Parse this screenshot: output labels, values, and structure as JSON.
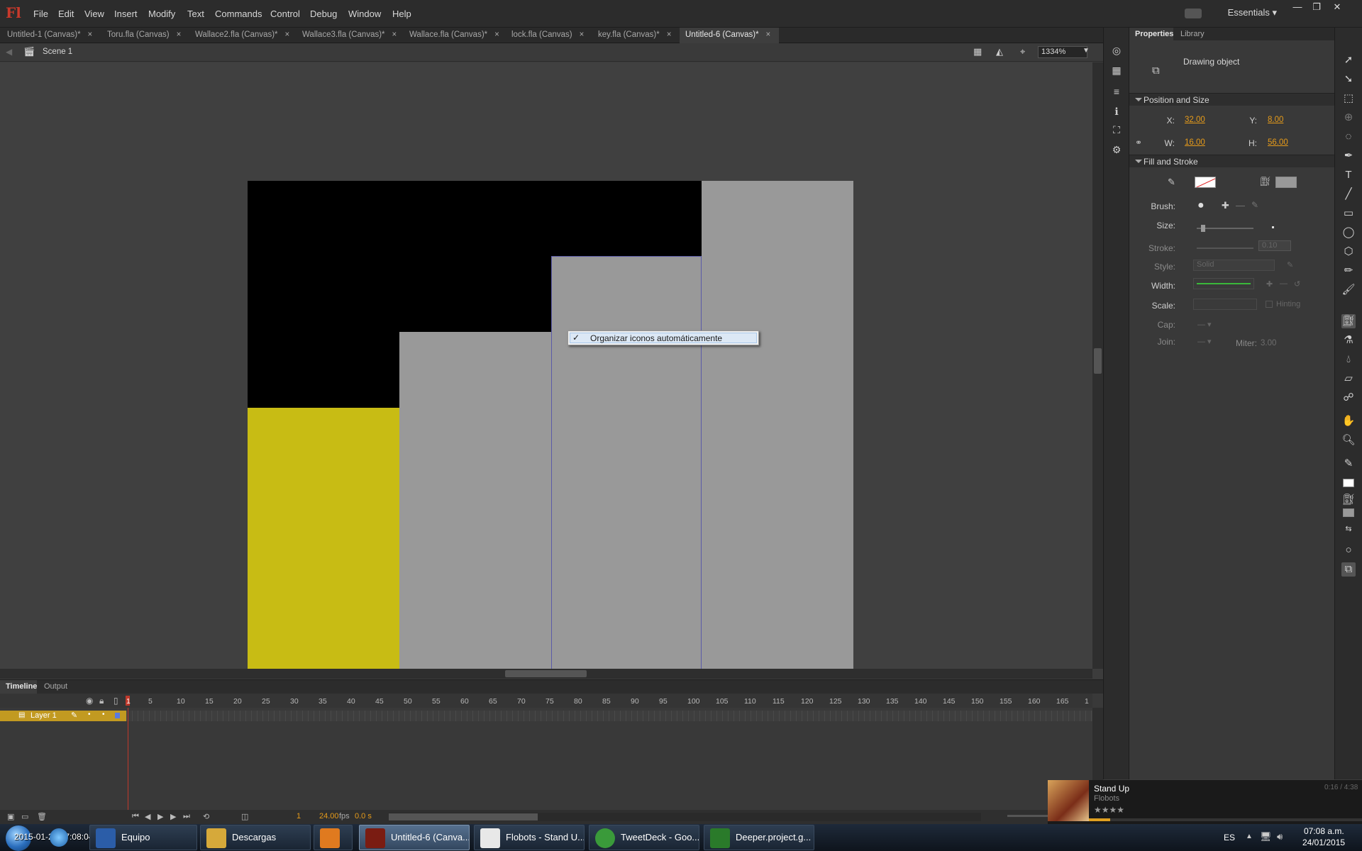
{
  "app": {
    "logo": "Fl"
  },
  "menu": [
    "File",
    "Edit",
    "View",
    "Insert",
    "Modify",
    "Text",
    "Commands",
    "Control",
    "Debug",
    "Window",
    "Help"
  ],
  "workspace": "Essentials",
  "tabs": [
    {
      "label": "Untitled-1 (Canvas)*",
      "active": false
    },
    {
      "label": "Toru.fla (Canvas)",
      "active": false
    },
    {
      "label": "Wallace2.fla (Canvas)*",
      "active": false
    },
    {
      "label": "Wallace3.fla (Canvas)*",
      "active": false
    },
    {
      "label": "Wallace.fla (Canvas)*",
      "active": false
    },
    {
      "label": "lock.fla (Canvas)",
      "active": false
    },
    {
      "label": "key.fla (Canvas)*",
      "active": false
    },
    {
      "label": "Untitled-6 (Canvas)*",
      "active": true
    }
  ],
  "tab_close": "×",
  "editbar": {
    "scene": "Scene 1",
    "zoom": "1334%"
  },
  "stage": {
    "colors": {
      "black": "#000000",
      "gray": "#999999",
      "yellow": "#c8bc14",
      "outline": "#5a5aa8"
    },
    "context_item": {
      "check": "✓",
      "label": "Organizar iconos automáticamente"
    }
  },
  "timeline": {
    "tabs": [
      "Timeline",
      "Output"
    ],
    "layer": "Layer 1",
    "frame_numbers": [
      "1",
      "5",
      "10",
      "15",
      "20",
      "25",
      "30",
      "35",
      "40",
      "45",
      "50",
      "55",
      "60",
      "65",
      "70",
      "75",
      "80",
      "85",
      "90",
      "95",
      "100",
      "105",
      "110",
      "115",
      "120",
      "125",
      "130",
      "135",
      "140",
      "145",
      "150",
      "155",
      "160",
      "165",
      "1"
    ],
    "current_frame": "1",
    "fps": "24.00",
    "fps_unit": "fps",
    "time": "0.0 s"
  },
  "properties": {
    "tabs": [
      "Properties",
      "Library"
    ],
    "object_type": "Drawing object",
    "position_section": "Position and Size",
    "x_label": "X:",
    "x": "32.00",
    "y_label": "Y:",
    "y": "8.00",
    "w_label": "W:",
    "w": "16.00",
    "h_label": "H:",
    "h": "56.00",
    "fill_section": "Fill and Stroke",
    "brush_label": "Brush:",
    "size_label": "Size:",
    "stroke_label": "Stroke:",
    "stroke_value": "0.10",
    "style_label": "Style:",
    "style_value": "Solid",
    "width_label": "Width:",
    "scale_label": "Scale:",
    "hinting_label": "Hinting",
    "cap_label": "Cap:",
    "join_label": "Join:",
    "miter_label": "Miter:",
    "miter_value": "3.00"
  },
  "media": {
    "title": "Stand Up",
    "artist": "Flobots",
    "time": "0:16 / 4:38"
  },
  "taskbar": {
    "items": [
      {
        "label": "Equipo",
        "active": false,
        "color": "#2b5da8"
      },
      {
        "label": "Descargas",
        "active": false,
        "color": "#d6a93a"
      },
      {
        "label": "",
        "active": false,
        "color": "#e07a1f"
      },
      {
        "label": "Untitled-6 (Canva...",
        "active": true,
        "color": "#7a1c12"
      },
      {
        "label": "Flobots - Stand U...",
        "active": false,
        "color": "#e8e8e8"
      },
      {
        "label": "TweetDeck - Goo...",
        "active": false,
        "color": "#3a9a3a"
      },
      {
        "label": "Deeper.project.g...",
        "active": false,
        "color": "#2a7a2a"
      }
    ],
    "overlay_text": "2015-01-24 07:08:04",
    "lang": "ES",
    "clock_time": "07:08 a.m.",
    "clock_date": "24/01/2015"
  }
}
